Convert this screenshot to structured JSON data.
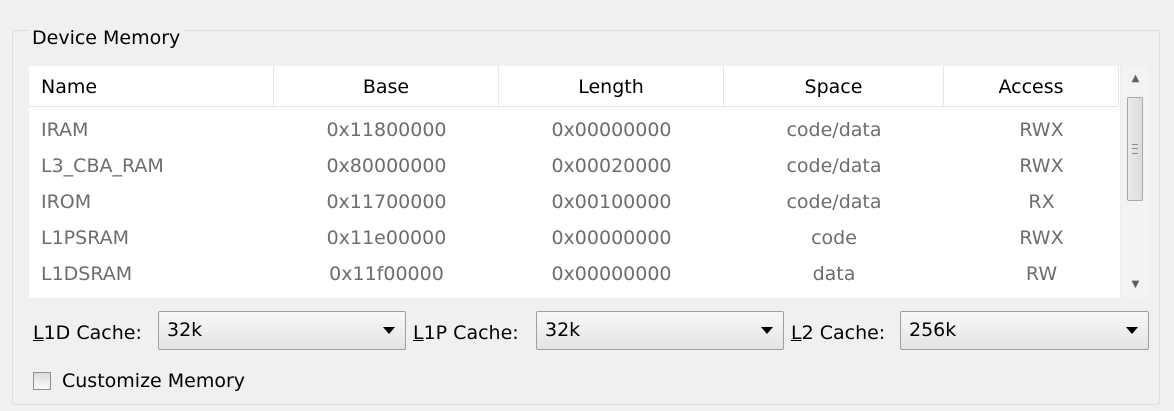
{
  "group": {
    "title": "Device Memory"
  },
  "table": {
    "columns": [
      "Name",
      "Base",
      "Length",
      "Space",
      "Access"
    ],
    "rows": [
      [
        "IRAM",
        "0x11800000",
        "0x00000000",
        "code/data",
        "RWX"
      ],
      [
        "L3_CBA_RAM",
        "0x80000000",
        "0x00020000",
        "code/data",
        "RWX"
      ],
      [
        "IROM",
        "0x11700000",
        "0x00100000",
        "code/data",
        "RX"
      ],
      [
        "L1PSRAM",
        "0x11e00000",
        "0x00000000",
        "code",
        "RWX"
      ],
      [
        "L1DSRAM",
        "0x11f00000",
        "0x00000000",
        "data",
        "RW"
      ]
    ]
  },
  "cache": {
    "l1d": {
      "label_mnemonic": "L",
      "label_rest": "1D Cache:",
      "value": "32k"
    },
    "l1p": {
      "label_mnemonic": "L",
      "label_rest": "1P Cache:",
      "value": "32k"
    },
    "l2": {
      "label_mnemonic": "L",
      "label_rest": "2 Cache:",
      "value": "256k"
    }
  },
  "customize": {
    "label": "Customize Memory",
    "checked": false
  },
  "icons": {
    "scroll_up": "arrow-up-icon",
    "scroll_down": "arrow-down-icon",
    "dropdown": "chevron-down-icon"
  }
}
